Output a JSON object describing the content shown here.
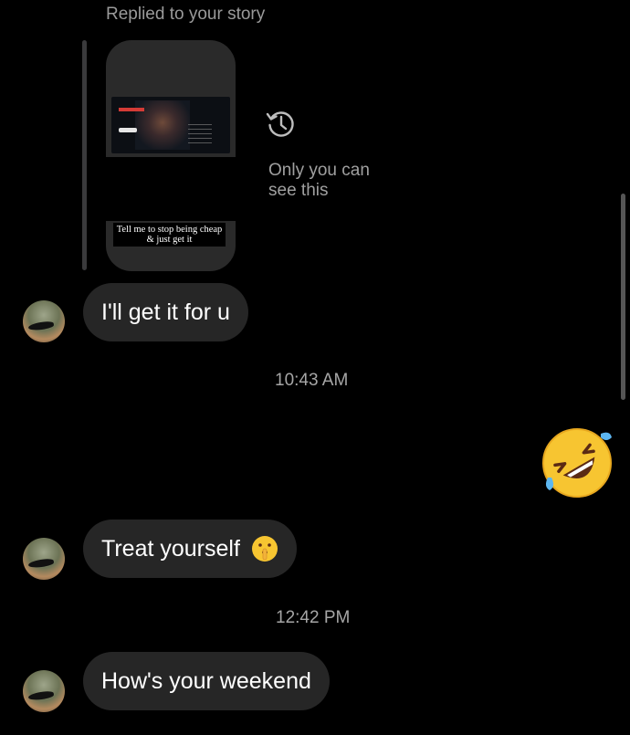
{
  "story_reply": {
    "label": "Replied to your story",
    "story_caption": "Tell me to stop being cheap & just get it",
    "privacy_note_line1": "Only you can",
    "privacy_note_line2": "see this",
    "icon": "history-clock-icon"
  },
  "messages": [
    {
      "type": "received",
      "text": "I'll get it for u"
    },
    {
      "type": "timestamp",
      "text": "10:43 AM"
    },
    {
      "type": "sent-emoji",
      "emoji": "🤣"
    },
    {
      "type": "received",
      "text": "Treat yourself",
      "emoji": "🤫"
    },
    {
      "type": "timestamp",
      "text": "12:42 PM"
    },
    {
      "type": "received",
      "text": "How's your weekend"
    }
  ],
  "colors": {
    "background": "#000000",
    "bubble": "#262626",
    "muted_text": "#9a9a9a"
  }
}
